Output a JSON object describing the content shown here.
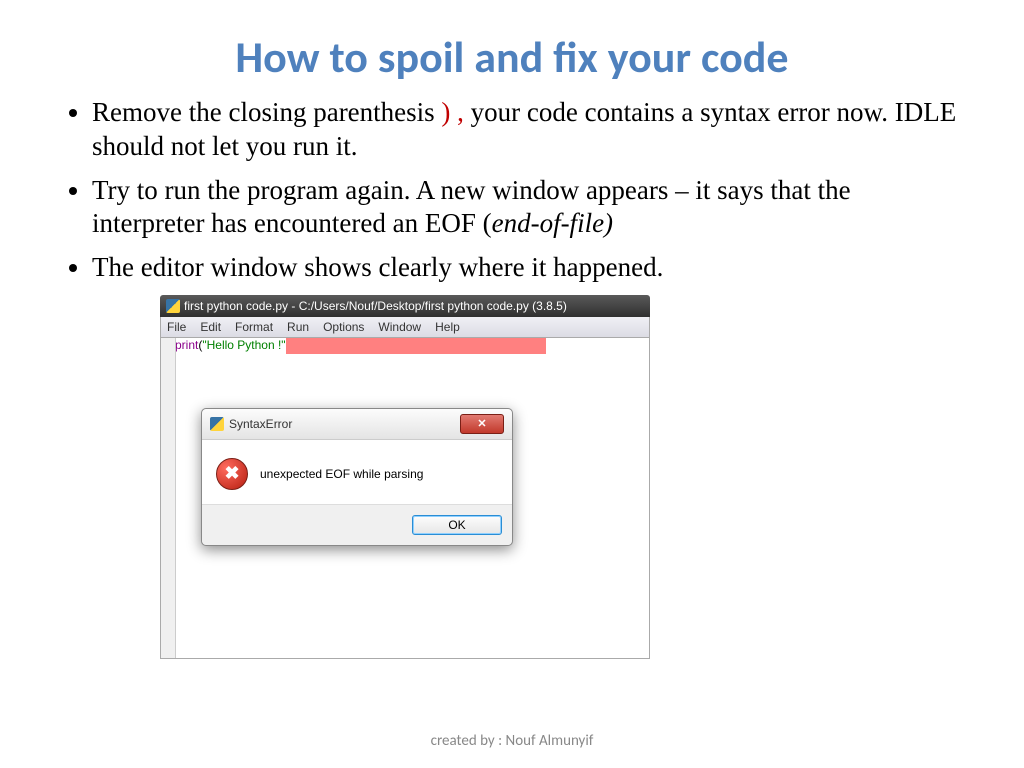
{
  "title": "How to spoil and fix your code",
  "bullets": {
    "b1_pre": "Remove the closing parenthesis ",
    "b1_red": ") ,",
    "b1_post": " your code contains a syntax error now. IDLE should not let you run it.",
    "b2_pre": "Try to run the program again. A new window appears – it says that the interpreter has encountered an EOF (",
    "b2_it": "end-of-file)",
    "b3": "The editor window shows clearly where it happened."
  },
  "ide": {
    "window_title": "first python code.py - C:/Users/Nouf/Desktop/first python code.py (3.8.5)",
    "menus": [
      "File",
      "Edit",
      "Format",
      "Run",
      "Options",
      "Window",
      "Help"
    ],
    "code_print": "print",
    "code_paren_open": "(",
    "code_str": "\"Hello Python !\""
  },
  "dialog": {
    "title": "SyntaxError",
    "message": "unexpected EOF while parsing",
    "ok": "OK",
    "close_glyph": "✕"
  },
  "footer": "created by : Nouf Almunyif"
}
